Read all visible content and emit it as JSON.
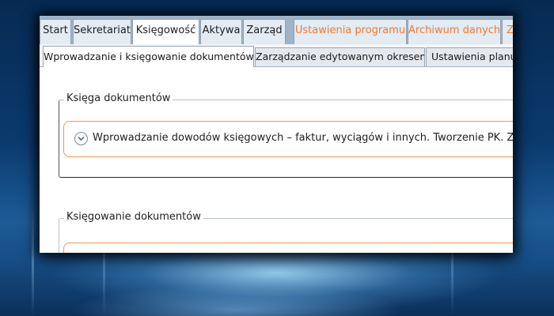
{
  "menu": {
    "tabs": [
      {
        "label": "Start"
      },
      {
        "label": "Sekretariat"
      },
      {
        "label": "Księgowość"
      },
      {
        "label": "Aktywa"
      },
      {
        "label": "Zarząd"
      },
      {
        "label": "Ustawienia programu"
      },
      {
        "label": "Archiwum danych"
      },
      {
        "label": "Z"
      }
    ],
    "active_tab": "Księgowość",
    "accent_color": "#ef7a2a"
  },
  "subtabs": [
    {
      "label": "Wprowadzanie i księgowanie dokumentów"
    },
    {
      "label": "Zarządzanie edytowanym okresem"
    },
    {
      "label": "Ustawienia planu,"
    }
  ],
  "groups": [
    {
      "label": "Księga dokumentów",
      "items": [
        {
          "icon": "chevron-down-icon",
          "text": "Wprowadzanie dowodów księgowych – faktur, wyciągów i innych. Tworzenie PK. Zbiorc"
        }
      ]
    },
    {
      "label": "Księgowanie dokumentów"
    }
  ]
}
